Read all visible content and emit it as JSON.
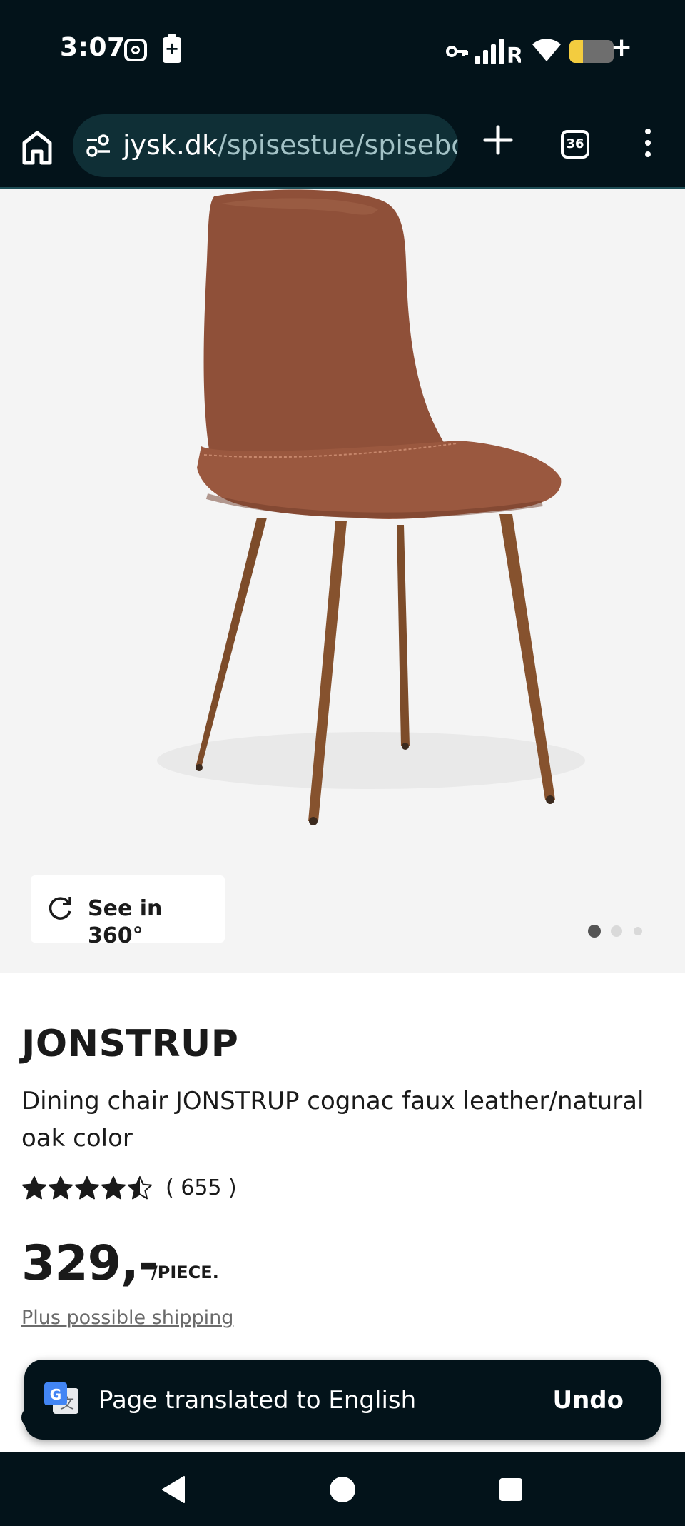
{
  "status_bar": {
    "time": "3:07",
    "icons": [
      "instagram-icon",
      "battery-saver-icon",
      "vpn-key-icon",
      "signal-icon",
      "wifi-icon",
      "battery-icon",
      "charging-icon"
    ],
    "battery_level": 0.3,
    "charging_symbol": "+"
  },
  "browser": {
    "url_domain": "jysk.dk",
    "url_path": "/spisestue/spisebor",
    "tab_count": "36",
    "icons": [
      "home-icon",
      "site-settings-icon",
      "plus-icon",
      "more-vert-icon"
    ]
  },
  "gallery": {
    "see_360_label": "See in 360°",
    "active_slide": 1,
    "slide_count": 3
  },
  "product": {
    "brand": "JONSTRUP",
    "description": "Dining chair JONSTRUP cognac faux leather/natural oak color",
    "rating": 4.5,
    "rating_max": 5,
    "review_count": "( 655 )",
    "price": "329,-",
    "price_unit": "/PIECE.",
    "shipping_link": "Plus possible shipping"
  },
  "toast": {
    "message": "Page translated to English",
    "action_label": "Undo"
  },
  "colors": {
    "chrome_dark": "#03131a",
    "url_pill": "#0f2f36",
    "url_path": "#a3c2c6",
    "chair_leather": "#8f5039",
    "chair_wood": "#7d4c2a",
    "image_bg": "#f4f4f4"
  }
}
